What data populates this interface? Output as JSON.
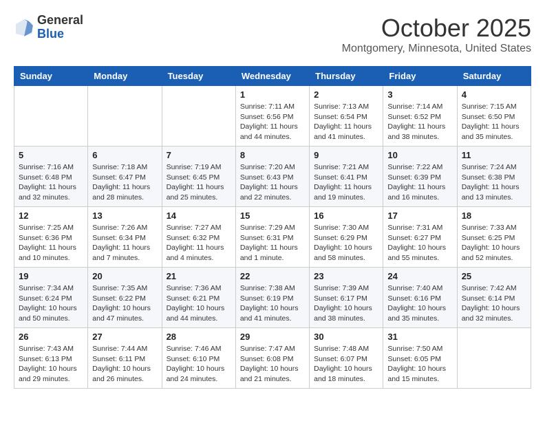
{
  "logo": {
    "general": "General",
    "blue": "Blue"
  },
  "title": "October 2025",
  "location": "Montgomery, Minnesota, United States",
  "days_header": [
    "Sunday",
    "Monday",
    "Tuesday",
    "Wednesday",
    "Thursday",
    "Friday",
    "Saturday"
  ],
  "weeks": [
    [
      {
        "day": "",
        "info": ""
      },
      {
        "day": "",
        "info": ""
      },
      {
        "day": "",
        "info": ""
      },
      {
        "day": "1",
        "info": "Sunrise: 7:11 AM\nSunset: 6:56 PM\nDaylight: 11 hours\nand 44 minutes."
      },
      {
        "day": "2",
        "info": "Sunrise: 7:13 AM\nSunset: 6:54 PM\nDaylight: 11 hours\nand 41 minutes."
      },
      {
        "day": "3",
        "info": "Sunrise: 7:14 AM\nSunset: 6:52 PM\nDaylight: 11 hours\nand 38 minutes."
      },
      {
        "day": "4",
        "info": "Sunrise: 7:15 AM\nSunset: 6:50 PM\nDaylight: 11 hours\nand 35 minutes."
      }
    ],
    [
      {
        "day": "5",
        "info": "Sunrise: 7:16 AM\nSunset: 6:48 PM\nDaylight: 11 hours\nand 32 minutes."
      },
      {
        "day": "6",
        "info": "Sunrise: 7:18 AM\nSunset: 6:47 PM\nDaylight: 11 hours\nand 28 minutes."
      },
      {
        "day": "7",
        "info": "Sunrise: 7:19 AM\nSunset: 6:45 PM\nDaylight: 11 hours\nand 25 minutes."
      },
      {
        "day": "8",
        "info": "Sunrise: 7:20 AM\nSunset: 6:43 PM\nDaylight: 11 hours\nand 22 minutes."
      },
      {
        "day": "9",
        "info": "Sunrise: 7:21 AM\nSunset: 6:41 PM\nDaylight: 11 hours\nand 19 minutes."
      },
      {
        "day": "10",
        "info": "Sunrise: 7:22 AM\nSunset: 6:39 PM\nDaylight: 11 hours\nand 16 minutes."
      },
      {
        "day": "11",
        "info": "Sunrise: 7:24 AM\nSunset: 6:38 PM\nDaylight: 11 hours\nand 13 minutes."
      }
    ],
    [
      {
        "day": "12",
        "info": "Sunrise: 7:25 AM\nSunset: 6:36 PM\nDaylight: 11 hours\nand 10 minutes."
      },
      {
        "day": "13",
        "info": "Sunrise: 7:26 AM\nSunset: 6:34 PM\nDaylight: 11 hours\nand 7 minutes."
      },
      {
        "day": "14",
        "info": "Sunrise: 7:27 AM\nSunset: 6:32 PM\nDaylight: 11 hours\nand 4 minutes."
      },
      {
        "day": "15",
        "info": "Sunrise: 7:29 AM\nSunset: 6:31 PM\nDaylight: 11 hours\nand 1 minute."
      },
      {
        "day": "16",
        "info": "Sunrise: 7:30 AM\nSunset: 6:29 PM\nDaylight: 10 hours\nand 58 minutes."
      },
      {
        "day": "17",
        "info": "Sunrise: 7:31 AM\nSunset: 6:27 PM\nDaylight: 10 hours\nand 55 minutes."
      },
      {
        "day": "18",
        "info": "Sunrise: 7:33 AM\nSunset: 6:25 PM\nDaylight: 10 hours\nand 52 minutes."
      }
    ],
    [
      {
        "day": "19",
        "info": "Sunrise: 7:34 AM\nSunset: 6:24 PM\nDaylight: 10 hours\nand 50 minutes."
      },
      {
        "day": "20",
        "info": "Sunrise: 7:35 AM\nSunset: 6:22 PM\nDaylight: 10 hours\nand 47 minutes."
      },
      {
        "day": "21",
        "info": "Sunrise: 7:36 AM\nSunset: 6:21 PM\nDaylight: 10 hours\nand 44 minutes."
      },
      {
        "day": "22",
        "info": "Sunrise: 7:38 AM\nSunset: 6:19 PM\nDaylight: 10 hours\nand 41 minutes."
      },
      {
        "day": "23",
        "info": "Sunrise: 7:39 AM\nSunset: 6:17 PM\nDaylight: 10 hours\nand 38 minutes."
      },
      {
        "day": "24",
        "info": "Sunrise: 7:40 AM\nSunset: 6:16 PM\nDaylight: 10 hours\nand 35 minutes."
      },
      {
        "day": "25",
        "info": "Sunrise: 7:42 AM\nSunset: 6:14 PM\nDaylight: 10 hours\nand 32 minutes."
      }
    ],
    [
      {
        "day": "26",
        "info": "Sunrise: 7:43 AM\nSunset: 6:13 PM\nDaylight: 10 hours\nand 29 minutes."
      },
      {
        "day": "27",
        "info": "Sunrise: 7:44 AM\nSunset: 6:11 PM\nDaylight: 10 hours\nand 26 minutes."
      },
      {
        "day": "28",
        "info": "Sunrise: 7:46 AM\nSunset: 6:10 PM\nDaylight: 10 hours\nand 24 minutes."
      },
      {
        "day": "29",
        "info": "Sunrise: 7:47 AM\nSunset: 6:08 PM\nDaylight: 10 hours\nand 21 minutes."
      },
      {
        "day": "30",
        "info": "Sunrise: 7:48 AM\nSunset: 6:07 PM\nDaylight: 10 hours\nand 18 minutes."
      },
      {
        "day": "31",
        "info": "Sunrise: 7:50 AM\nSunset: 6:05 PM\nDaylight: 10 hours\nand 15 minutes."
      },
      {
        "day": "",
        "info": ""
      }
    ]
  ]
}
